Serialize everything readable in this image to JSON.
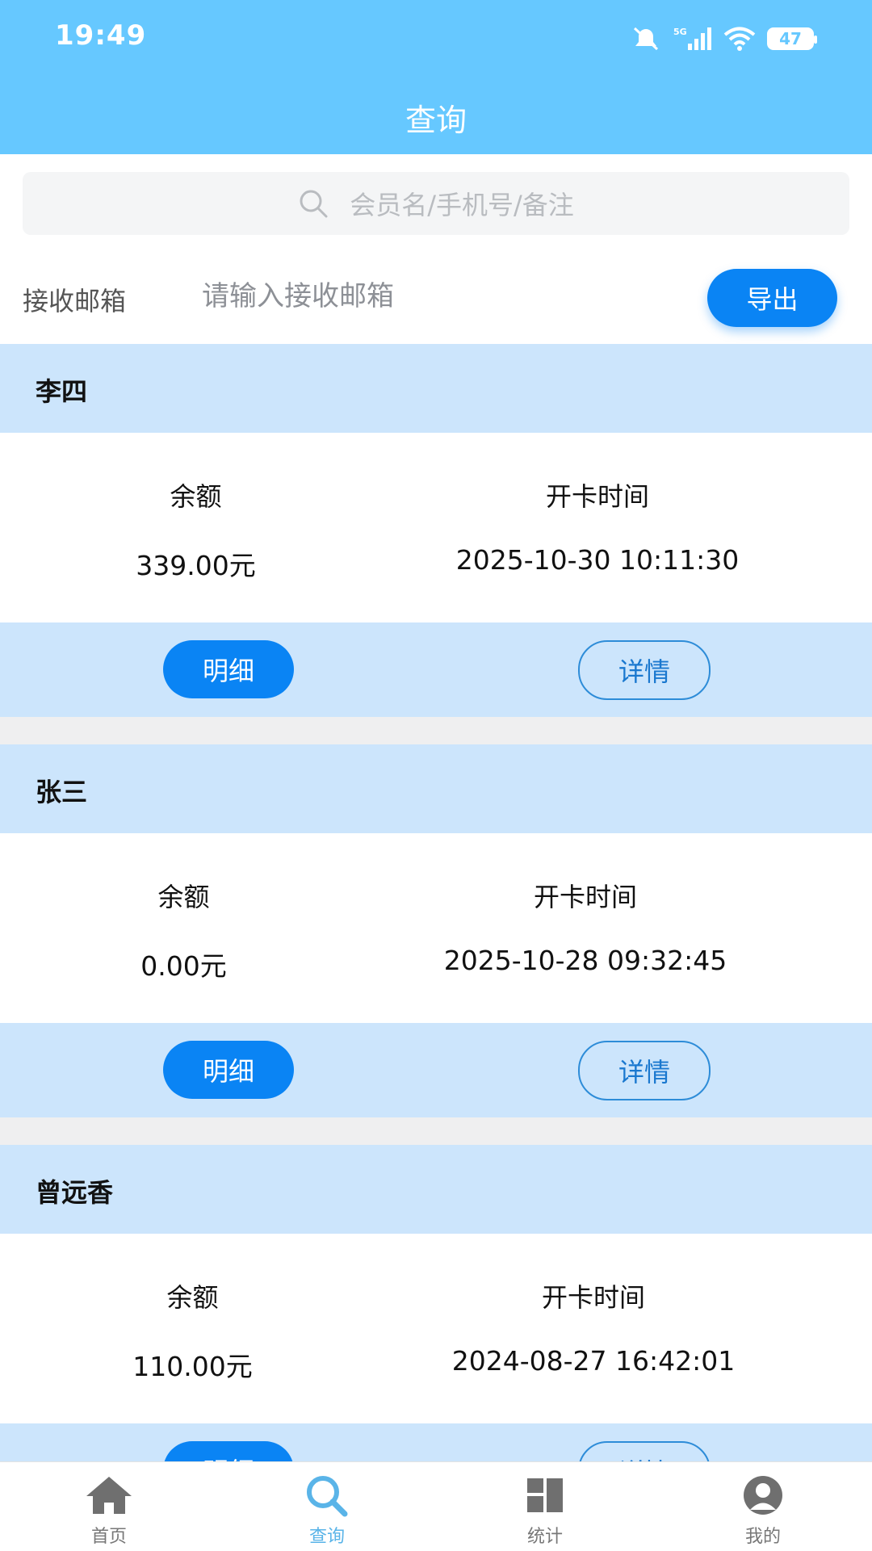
{
  "status_bar": {
    "time": "19:49",
    "network": "5G",
    "battery": "47"
  },
  "header": {
    "title": "查询"
  },
  "search": {
    "placeholder": "会员名/手机号/备注"
  },
  "email_row": {
    "label": "接收邮箱",
    "placeholder": "请输入接收邮箱",
    "value": "",
    "export_label": "导出"
  },
  "members": [
    {
      "name": "李四",
      "balance_label": "余额",
      "balance": "339.00元",
      "opened_label": "开卡时间",
      "opened_at": "2025-10-30 10:11:30",
      "detail_label": "明细",
      "info_label": "详情"
    },
    {
      "name": "张三",
      "balance_label": "余额",
      "balance": "0.00元",
      "opened_label": "开卡时间",
      "opened_at": "2025-10-28 09:32:45",
      "detail_label": "明细",
      "info_label": "详情"
    },
    {
      "name": "曾远香",
      "balance_label": "余额",
      "balance": "110.00元",
      "opened_label": "开卡时间",
      "opened_at": "2024-08-27 16:42:01",
      "detail_label": "明细",
      "info_label": "详情"
    }
  ],
  "bottom_nav": {
    "items": [
      {
        "label": "首页",
        "icon": "home-icon",
        "active": false
      },
      {
        "label": "查询",
        "icon": "search-icon",
        "active": true
      },
      {
        "label": "统计",
        "icon": "stats-icon",
        "active": false
      },
      {
        "label": "我的",
        "icon": "profile-icon",
        "active": false
      }
    ]
  },
  "colors": {
    "header_bg": "#66C8FF",
    "primary": "#0A84F4",
    "card_band": "#CCE5FC",
    "active_tab": "#5AB4E8"
  }
}
